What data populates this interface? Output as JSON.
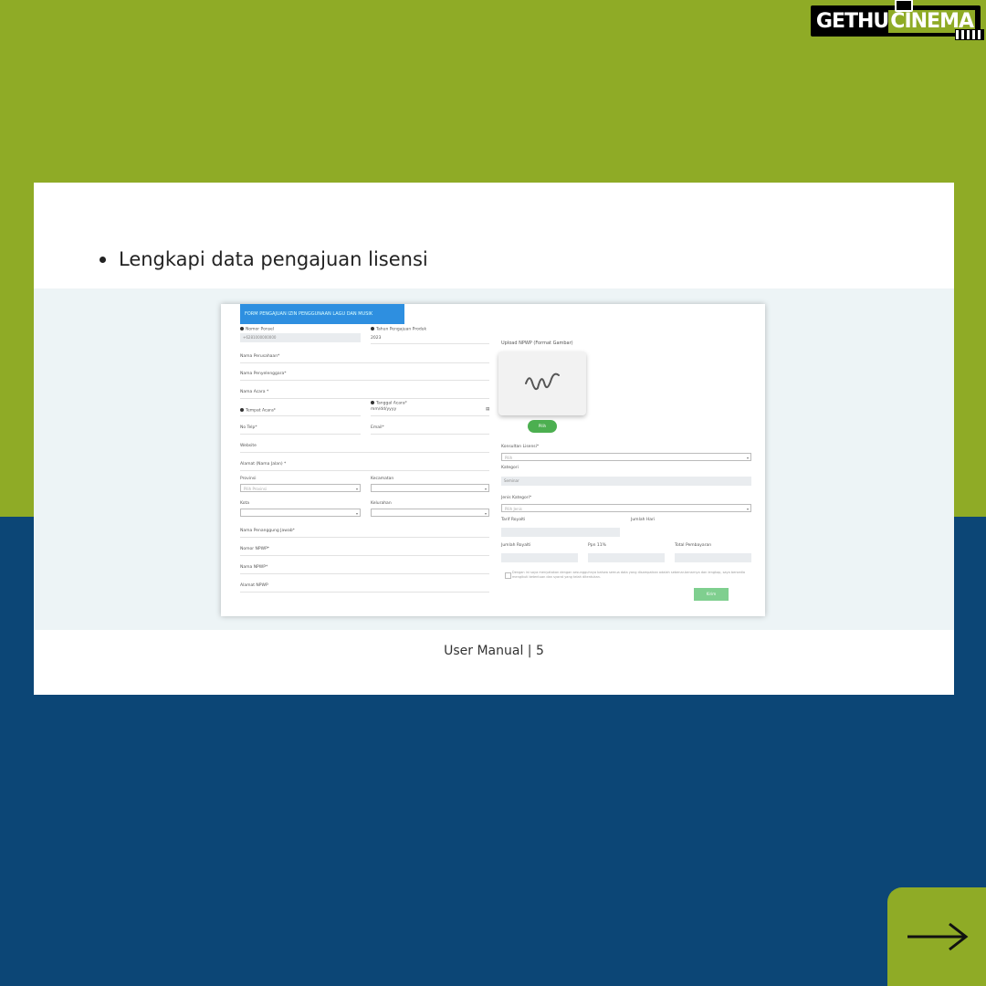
{
  "brand": {
    "part1": "GETHU",
    "part2": "CINEMA"
  },
  "slide": {
    "bullet_text": "Lengkapi data pengajuan lisensi",
    "footer": "User Manual | 5"
  },
  "form": {
    "header": "FORM PENGAJUAN IZIN PENGGUNAAN LAGU DAN MUSIK",
    "nomor_ponsel_label": "Nomor Ponsel",
    "nomor_ponsel_value": "+6281000000000",
    "tahun_label": "Tahun Pengajuan Produk",
    "tahun_value": "2023",
    "nama_perusahaan": "Nama Perusahaan*",
    "nama_penyelenggara": "Nama Penyelenggara*",
    "nama_acara": "Nama Acara *",
    "tempat_acara": "Tempat Acara*",
    "tanggal_acara_label": "Tanggal Acara*",
    "tanggal_acara_placeholder": "mm/dd/yyyy",
    "no_telp": "No Telp*",
    "email": "Email*",
    "website": "Website",
    "alamat": "Alamat (Nama Jalan) *",
    "provinsi": "Provinsi",
    "provinsi_placeholder": "Pilih Provinsi",
    "kecamatan": "Kecamatan",
    "kota": "Kota",
    "kelurahan": "Kelurahan",
    "nama_penanggung_jawab": "Nama Penanggung Jawab*",
    "nomor_npwp": "Nomor NPWP*",
    "nama_npwp": "Nama NPWP*",
    "alamat_npwp": "Alamat NPWP",
    "upload_label": "Upload NPWP (Format Gambar)",
    "pilih_button": "Pilih",
    "konsultan_label": "Konsultan Lisensi*",
    "konsultan_placeholder": "Pilih",
    "kategori_label": "Kategori",
    "kategori_value": "Seminar",
    "jenis_kategori_label": "Jenis Kategori*",
    "jenis_kategori_placeholder": "Pilih Jenis",
    "tarif_label": "Tarif Royalti",
    "jumlah_hari_label": "Jumlah Hari",
    "jumlah_royalti_label": "Jumlah Royalti",
    "ppn_label": "Ppn 11%",
    "total_label": "Total Pembayaran",
    "agreement": "Dengan ini saya menyatakan dengan sesungguhnya bahwa semua data yang disampaikan adalah sebenar-benarnya dan lengkap, saya bersedia mengikuti ketentuan dan syarat yang telah ditentukan.",
    "submit_button": "Kirim"
  },
  "colors": {
    "green": "#8fab26",
    "navy": "#0c4676",
    "form_blue": "#2e8fe0"
  },
  "icons": {
    "next": "arrow-right-icon",
    "upload": "signature-placeholder-icon"
  }
}
